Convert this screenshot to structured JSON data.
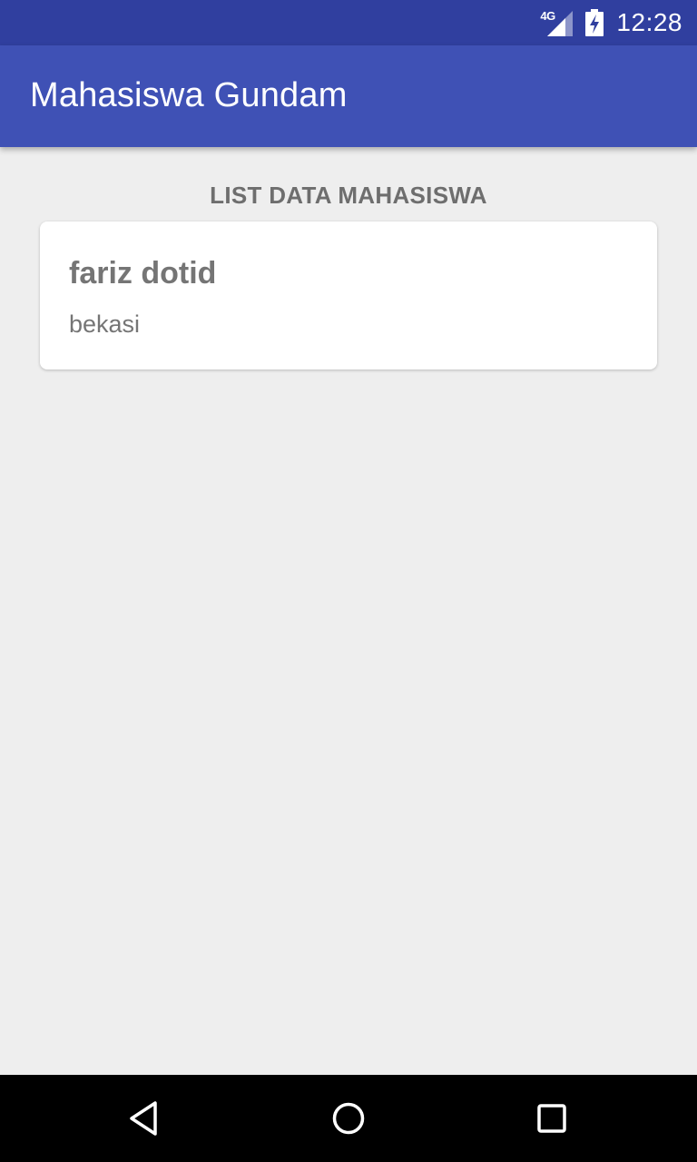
{
  "status_bar": {
    "network_label": "4G",
    "time": "12:28",
    "icons": [
      "signal-icon",
      "battery-icon"
    ]
  },
  "app_bar": {
    "title": "Mahasiswa Gundam"
  },
  "content": {
    "heading": "LIST DATA MAHASISWA",
    "students": [
      {
        "name": "fariz dotid",
        "city": "bekasi"
      }
    ]
  },
  "nav_bar": {
    "icons": [
      "back-icon",
      "home-icon",
      "recent-apps-icon"
    ]
  },
  "colors": {
    "status_bar": "#303F9F",
    "app_bar": "#3F51B5",
    "background": "#EEEEEE",
    "card": "#FFFFFF",
    "text_secondary": "#757575",
    "nav_bar": "#000000"
  }
}
